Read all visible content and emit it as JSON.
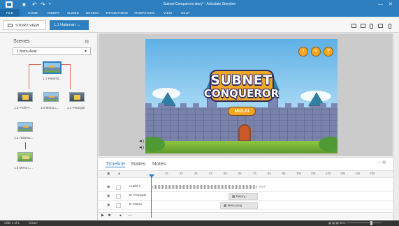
{
  "window": {
    "title": "Subnet Conquerors story* - Articulate Storyline",
    "quick_access": [
      "save-icon",
      "undo-icon",
      "redo-icon",
      "more-icon"
    ],
    "controls": [
      "minimize-icon",
      "close-icon"
    ]
  },
  "menu": {
    "items": [
      "FILE",
      "HOME",
      "INSERT",
      "SLIDES",
      "DESIGN",
      "TRANSITIONS",
      "ANIMATIONS",
      "VIEW",
      "HELP"
    ]
  },
  "tabs": {
    "story_view": "STORY VIEW",
    "active_slide": "1.1 Halaman ..."
  },
  "scenes": {
    "header": "Scenes",
    "selected": "1 Menu Awal",
    "slides": [
      {
        "label": "1.1 Halama...",
        "kind": "game",
        "selected": true
      },
      {
        "label": "1.2 Profil P...",
        "kind": "dark"
      },
      {
        "label": "1.6 Menu L...",
        "kind": "game"
      },
      {
        "label": "1.4 Petunjuk",
        "kind": "dark"
      },
      {
        "label": "1.2 Halama...",
        "kind": "game"
      },
      {
        "label": "1.5 Menu L...",
        "kind": "green"
      }
    ]
  },
  "slide": {
    "logo_line1": "SUBNET",
    "logo_line2": "CONQUEROR",
    "start_button": "MULAI",
    "top_buttons": [
      "!",
      "≡",
      "?"
    ]
  },
  "timeline": {
    "tabs": [
      "Timeline",
      "States",
      "Notes"
    ],
    "ticks": [
      "1s",
      "2s",
      "3s",
      "4s",
      "5s",
      "6s",
      "7s",
      "8s",
      "9s",
      "10s",
      "11s",
      "12s",
      "13s",
      "14s",
      "15s"
    ],
    "end_marker": "End",
    "rows": [
      {
        "name": "Audio 1",
        "bar": ""
      },
      {
        "name": "B. Petunjuk",
        "bar": "Petunj..."
      },
      {
        "name": "B. Menu",
        "bar": "Menu.png"
      }
    ]
  },
  "status": {
    "slide": "Slide 1 of 6",
    "theme": "\"Clean\"",
    "zoom": "95%"
  },
  "colors": {
    "accent": "#2d7fbf",
    "button_orange": "#f6a522"
  }
}
